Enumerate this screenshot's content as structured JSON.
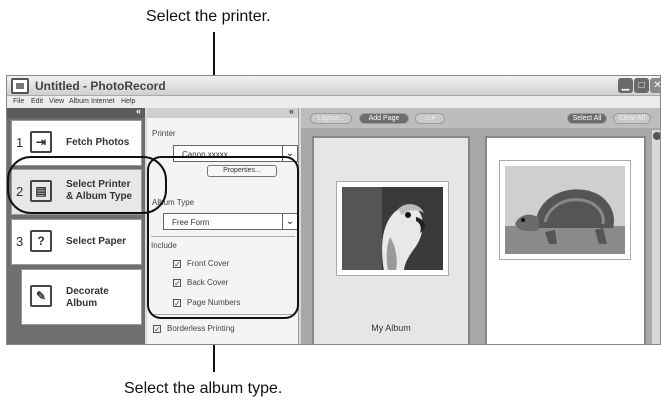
{
  "callouts": {
    "top": "Select the printer.",
    "bottom": "Select the album type."
  },
  "window": {
    "title": "Untitled - PhotoRecord",
    "icon": "photo-app-icon",
    "controls": {
      "minimize": "minimize-icon",
      "maximize": "maximize-icon",
      "close": "close-icon"
    }
  },
  "menu": [
    "File",
    "Edit",
    "View",
    "Album",
    "Internet",
    "Help"
  ],
  "steps": {
    "collapse": "«",
    "items": [
      {
        "num": "1",
        "label": "Fetch Photos",
        "icon": "fetch-photos-icon"
      },
      {
        "num": "2",
        "label": "Select Printer\n& Album Type",
        "icon": "printer-album-icon"
      },
      {
        "num": "3",
        "label": "Select Paper",
        "icon": "paper-icon"
      },
      {
        "num": "",
        "label": "Decorate\nAlbum",
        "icon": "decorate-icon"
      }
    ]
  },
  "settings": {
    "collapse": "«",
    "printer_label": "Printer",
    "printer_value": "Canon xxxxx",
    "properties_button": "Properties...",
    "album_type_label": "Album Type",
    "album_type_value": "Free Form",
    "include_label": "Include",
    "front_cover": "Front Cover",
    "back_cover": "Back Cover",
    "page_numbers": "Page Numbers",
    "borderless": "Borderless Printing"
  },
  "toolbar": {
    "layout": "Layout...",
    "add_page": "Add Page",
    "select_all": "Select All",
    "clear_all": "Clear All"
  },
  "album": {
    "left_page_title": "My Album",
    "left_photo": "parrot-photo",
    "right_photo": "tortoise-photo"
  }
}
